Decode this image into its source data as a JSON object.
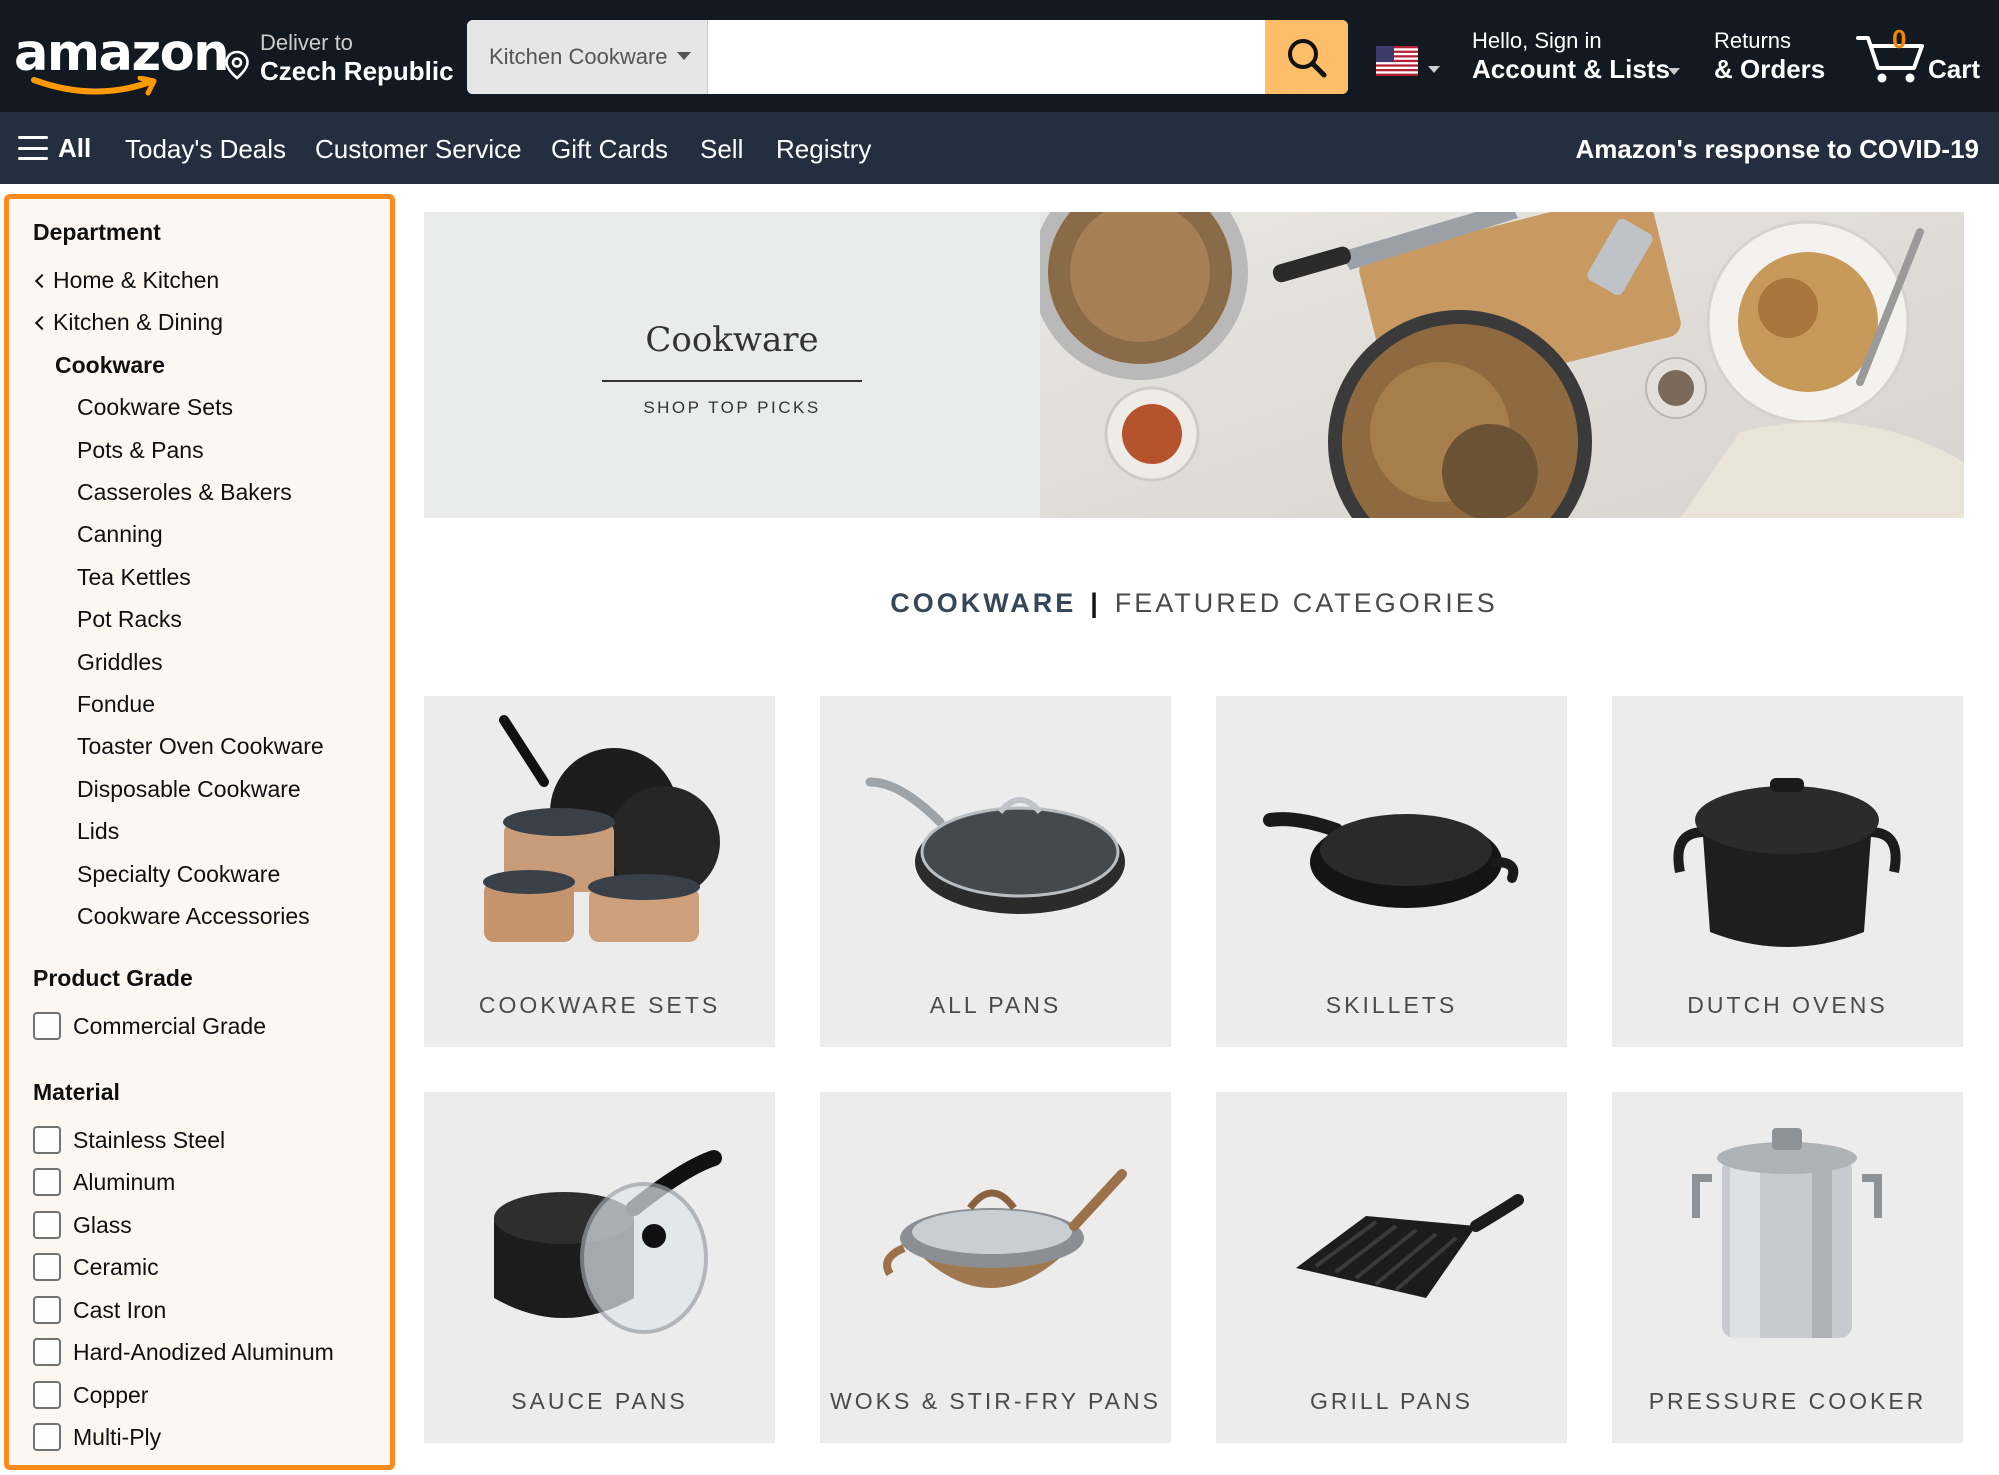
{
  "header": {
    "logo_text": "amazon",
    "deliver_to_label": "Deliver to",
    "deliver_to_location": "Czech Republic",
    "search": {
      "category": "Kitchen Cookware",
      "value": "",
      "placeholder": ""
    },
    "account_greeting": "Hello, Sign in",
    "account_label": "Account & Lists",
    "returns_label": "Returns",
    "orders_label": "& Orders",
    "cart_count": "0",
    "cart_label": "Cart",
    "colors": {
      "bar": "#131921",
      "search_button": "#febd69",
      "cart_count": "#f08804"
    }
  },
  "subnav": {
    "all_label": "All",
    "links": [
      "Today's Deals",
      "Customer Service",
      "Gift Cards",
      "Sell",
      "Registry"
    ],
    "covid_link": "Amazon's response to COVID-19"
  },
  "sidebar": {
    "department_heading": "Department",
    "breadcrumbs": [
      "Home & Kitchen",
      "Kitchen & Dining"
    ],
    "current_category": "Cookware",
    "subcategories": [
      "Cookware Sets",
      "Pots & Pans",
      "Casseroles & Bakers",
      "Canning",
      "Tea Kettles",
      "Pot Racks",
      "Griddles",
      "Fondue",
      "Toaster Oven Cookware",
      "Disposable Cookware",
      "Lids",
      "Specialty Cookware",
      "Cookware Accessories"
    ],
    "product_grade_heading": "Product Grade",
    "product_grade_options": [
      "Commercial Grade"
    ],
    "material_heading": "Material",
    "material_options": [
      "Stainless Steel",
      "Aluminum",
      "Glass",
      "Ceramic",
      "Cast Iron",
      "Hard-Anodized Aluminum",
      "Copper",
      "Multi-Ply"
    ],
    "highlight_color": "#ff8c1a"
  },
  "hero": {
    "title": "Cookware",
    "cta": "SHOP TOP PICKS"
  },
  "featured": {
    "title": "COOKWARE",
    "subtitle": "FEATURED CATEGORIES"
  },
  "categories": [
    {
      "label": "COOKWARE SETS",
      "icon": "cookware-set-icon"
    },
    {
      "label": "ALL PANS",
      "icon": "frying-pan-icon"
    },
    {
      "label": "SKILLETS",
      "icon": "skillet-icon"
    },
    {
      "label": "DUTCH OVENS",
      "icon": "dutch-oven-icon"
    },
    {
      "label": "SAUCE PANS",
      "icon": "sauce-pan-icon"
    },
    {
      "label": "WOKS & STIR-FRY PANS",
      "icon": "wok-icon"
    },
    {
      "label": "GRILL PANS",
      "icon": "grill-pan-icon"
    },
    {
      "label": "PRESSURE COOKER",
      "icon": "pressure-cooker-icon"
    }
  ]
}
